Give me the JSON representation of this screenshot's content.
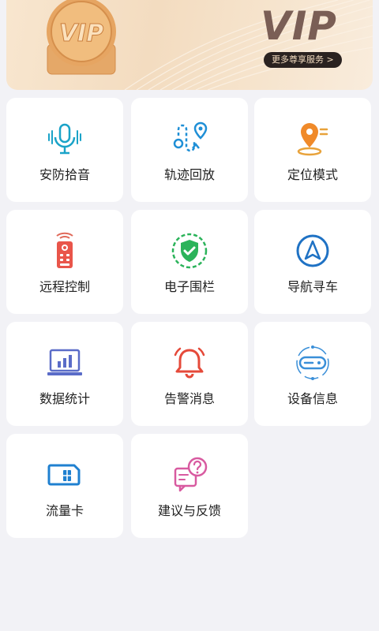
{
  "banner": {
    "vip_text": "VIP",
    "more_label": "更多尊享服务 >",
    "coin_text": "VIP",
    "colors": {
      "dark": "#7a5e55",
      "pill": "#2a2220",
      "gold": "#e2a15f"
    }
  },
  "features": [
    {
      "label": "安防拾音",
      "icon": "microphone-icon"
    },
    {
      "label": "轨迹回放",
      "icon": "route-icon"
    },
    {
      "label": "定位模式",
      "icon": "location-pin-icon"
    },
    {
      "label": "远程控制",
      "icon": "remote-control-icon"
    },
    {
      "label": "电子围栏",
      "icon": "shield-check-icon"
    },
    {
      "label": "导航寻车",
      "icon": "navigation-icon"
    },
    {
      "label": "数据统计",
      "icon": "bar-chart-icon"
    },
    {
      "label": "告警消息",
      "icon": "alarm-bell-icon"
    },
    {
      "label": "设备信息",
      "icon": "device-icon"
    },
    {
      "label": "流量卡",
      "icon": "sim-card-icon"
    },
    {
      "label": "建议与反馈",
      "icon": "feedback-icon"
    }
  ]
}
